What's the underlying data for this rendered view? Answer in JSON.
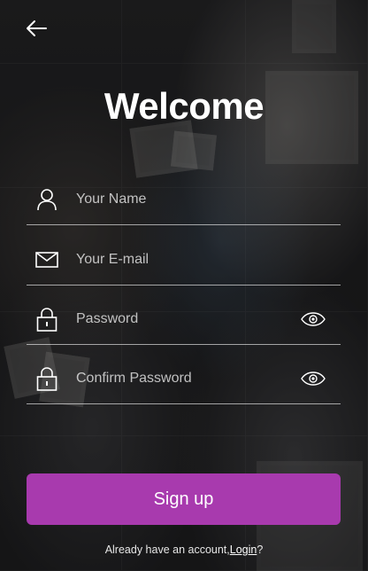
{
  "header": {
    "back_icon": "arrow-left-icon",
    "title": "Welcome"
  },
  "form": {
    "name": {
      "placeholder": "Your Name",
      "value": "",
      "icon": "user-icon"
    },
    "email": {
      "placeholder": "Your E-mail",
      "value": "",
      "icon": "mail-icon"
    },
    "password": {
      "placeholder": "Password",
      "value": "",
      "icon": "lock-icon",
      "toggle_icon": "eye-icon"
    },
    "confirm_password": {
      "placeholder": "Confirm Password",
      "value": "",
      "icon": "lock-icon",
      "toggle_icon": "eye-icon"
    }
  },
  "signup_label": "Sign up",
  "footer": {
    "prefix": "Already have an account,",
    "login_label": "Login",
    "suffix": "?"
  },
  "colors": {
    "accent": "#a83aae",
    "text": "#ffffff"
  }
}
